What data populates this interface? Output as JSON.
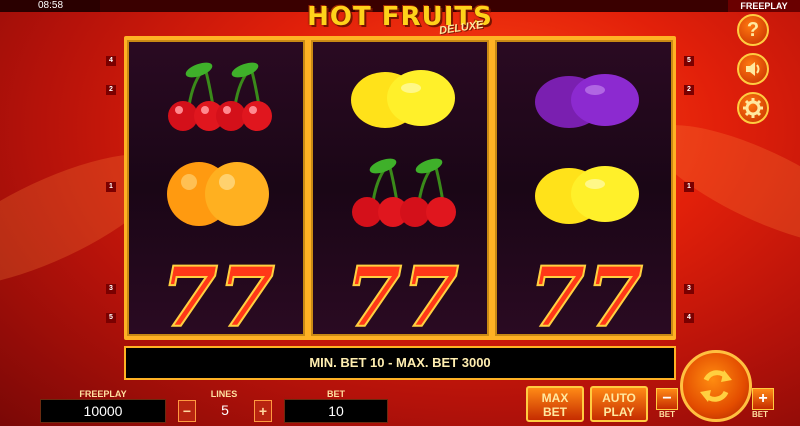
{
  "status_bar": {
    "time": "08:58",
    "mode": "FREEPLAY"
  },
  "logo": {
    "main": "HOT FRUITS",
    "sub": "DELUXE"
  },
  "reels": [
    {
      "symbols": [
        "cherries",
        "orange",
        "seven"
      ]
    },
    {
      "symbols": [
        "lemon",
        "cherries",
        "seven"
      ]
    },
    {
      "symbols": [
        "plum",
        "lemon",
        "seven"
      ]
    }
  ],
  "paylines": {
    "left": [
      "4",
      "2",
      "1",
      "3",
      "5"
    ],
    "right": [
      "5",
      "2",
      "1",
      "3",
      "4"
    ]
  },
  "message": "MIN. BET 10 - MAX. BET 3000",
  "icons": {
    "help": "question-icon",
    "sound": "speaker-icon",
    "settings": "gear-icon",
    "spin": "spin-arrows-icon"
  },
  "controls": {
    "freeplay_label": "FREEPLAY",
    "freeplay_value": "10000",
    "lines_label": "LINES",
    "lines_value": "5",
    "lines_minus": "−",
    "lines_plus": "+",
    "bet_label": "BET",
    "bet_value": "10",
    "max_bet_line1": "MAX",
    "max_bet_line2": "BET",
    "auto_play_line1": "AUTO",
    "auto_play_line2": "PLAY",
    "bet_minus": "−",
    "bet_minus_label": "BET",
    "bet_plus": "+",
    "bet_plus_label": "BET"
  },
  "colors": {
    "accent": "#ffb224",
    "background": "#e2200a",
    "reel": "#1a0616"
  }
}
